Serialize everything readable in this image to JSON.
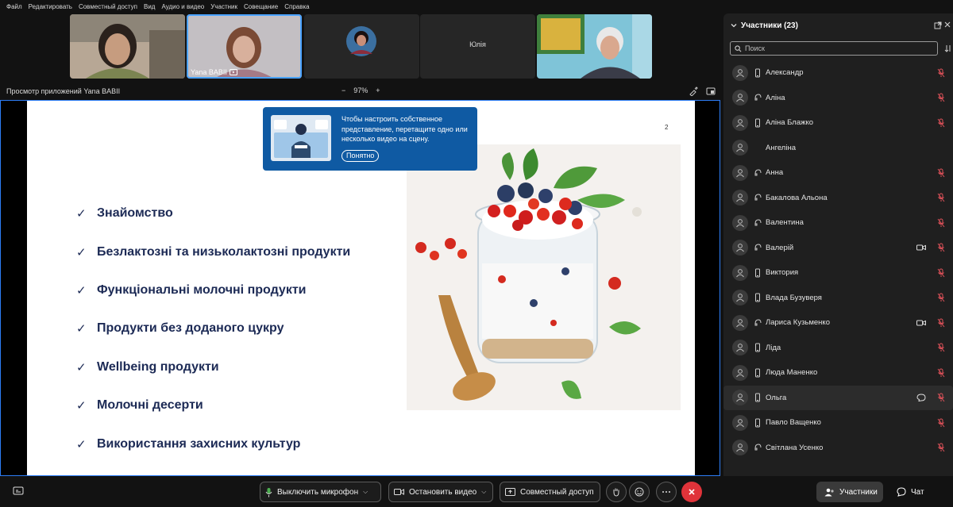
{
  "menubar": {
    "items": [
      "Файл",
      "Редактировать",
      "Совместный доступ",
      "Вид",
      "Аудио и видео",
      "Участник",
      "Совещание",
      "Справка"
    ]
  },
  "videos": {
    "tile2_name": "Yana BABII",
    "tile4_name": "Юлія"
  },
  "share": {
    "title": "Просмотр приложений Yana BABII",
    "zoom_minus": "−",
    "zoom_value": "97%",
    "zoom_plus": "+"
  },
  "slide": {
    "page_number": "2",
    "bullet_mark": "✓",
    "bullets": [
      "Знайомство",
      "Безлактозні та низьколактозні продукти",
      "Функціональні молочні продукти",
      "Продукти без доданого цукру",
      "Wellbeing продукти",
      "Молочні десерти",
      "Використання захисних культур"
    ]
  },
  "tooltip": {
    "text": "Чтобы настроить собственное представление, перетащите одно или несколько видео на сцену.",
    "button": "Понятно"
  },
  "panel": {
    "title": "Участники (23)",
    "search_placeholder": "Поиск",
    "participants": [
      {
        "name": "Александр",
        "device": "phone",
        "video": false,
        "mic": "muted"
      },
      {
        "name": "Аліна",
        "device": "audio",
        "video": false,
        "mic": "muted"
      },
      {
        "name": "Аліна Блажко",
        "device": "phone",
        "video": false,
        "mic": "muted"
      },
      {
        "name": "Ангеліна",
        "device": "none",
        "video": false,
        "mic": "none"
      },
      {
        "name": "Анна",
        "device": "audio",
        "video": false,
        "mic": "muted"
      },
      {
        "name": "Бакалова Альона",
        "device": "audio",
        "video": false,
        "mic": "muted"
      },
      {
        "name": "Валентина",
        "device": "audio",
        "video": false,
        "mic": "muted"
      },
      {
        "name": "Валерій",
        "device": "audio",
        "video": true,
        "mic": "muted"
      },
      {
        "name": "Виктория",
        "device": "phone",
        "video": false,
        "mic": "muted"
      },
      {
        "name": "Влада Бузуверя",
        "device": "phone",
        "video": false,
        "mic": "muted"
      },
      {
        "name": "Лариса Кузьменко",
        "device": "audio",
        "video": true,
        "mic": "muted"
      },
      {
        "name": "Ліда",
        "device": "phone",
        "video": false,
        "mic": "muted"
      },
      {
        "name": "Люда Маненко",
        "device": "phone",
        "video": false,
        "mic": "muted"
      },
      {
        "name": "Ольга",
        "device": "phone",
        "video": false,
        "mic": "muted",
        "chat": true
      },
      {
        "name": "Павло Ващенко",
        "device": "phone",
        "video": false,
        "mic": "muted"
      },
      {
        "name": "Світлана Усенко",
        "device": "audio",
        "video": false,
        "mic": "muted"
      }
    ]
  },
  "bottombar": {
    "mic_label": "Выключить микрофон",
    "video_label": "Остановить видео",
    "share_label": "Совместный доступ",
    "participants_label": "Участники",
    "chat_label": "Чат"
  },
  "colors": {
    "accent": "#2d7df6",
    "tooltip_bg": "#0f5aa3",
    "end_call": "#e0333a",
    "muted_red": "#e0525a",
    "slide_text": "#1c2a55"
  }
}
